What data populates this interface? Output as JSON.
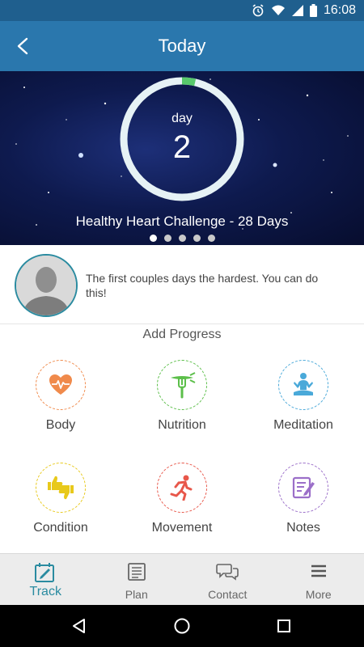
{
  "status_bar": {
    "time": "16:08"
  },
  "app_bar": {
    "title": "Today"
  },
  "hero": {
    "day_label": "day",
    "day_number": "2",
    "progress_fraction": 0.036,
    "challenge": "Healthy Heart Challenge  - 28 Days",
    "page_count": 5,
    "active_page": 0
  },
  "coach": {
    "message": "The first couples days the hardest. You can do this!"
  },
  "progress": {
    "heading": "Add Progress",
    "items": [
      {
        "label": "Body",
        "icon": "heart-pulse-icon",
        "color": "#f08a4b"
      },
      {
        "label": "Nutrition",
        "icon": "carrot-fork-icon",
        "color": "#5cbf4a"
      },
      {
        "label": "Meditation",
        "icon": "meditation-pose-icon",
        "color": "#4aa9d9"
      },
      {
        "label": "Condition",
        "icon": "thumbs-up-down-icon",
        "color": "#e8c91b"
      },
      {
        "label": "Movement",
        "icon": "running-person-icon",
        "color": "#e8574a"
      },
      {
        "label": "Notes",
        "icon": "notepad-pencil-icon",
        "color": "#9b6fc9"
      }
    ]
  },
  "bottom_nav": [
    {
      "label": "Track",
      "icon": "track-edit-icon",
      "active": true
    },
    {
      "label": "Plan",
      "icon": "plan-list-icon",
      "active": false
    },
    {
      "label": "Contact",
      "icon": "chat-bubbles-icon",
      "active": false
    },
    {
      "label": "More",
      "icon": "menu-icon",
      "active": false
    }
  ],
  "colors": {
    "status_bar": "#1f5f8e",
    "app_bar": "#2a77ad",
    "accent": "#2a8ba0",
    "ring_track": "#e6f2f5",
    "ring_progress": "#57c86b"
  }
}
